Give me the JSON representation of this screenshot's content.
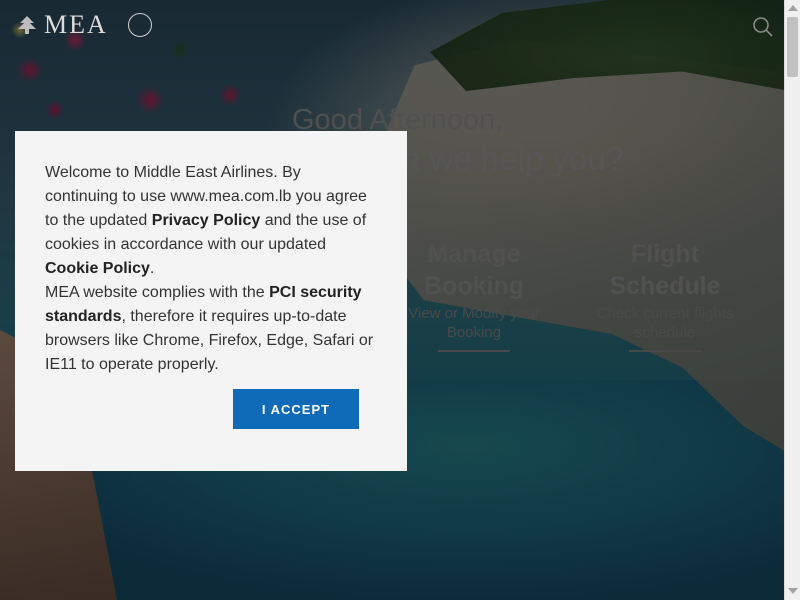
{
  "header": {
    "logo_text": "MEA",
    "logo_icon": "cedar-icon",
    "alliance_icon": "globe-icon",
    "search_icon": "search-icon"
  },
  "hero": {
    "greeting": "Good Afternoon,",
    "question": "How can we help you?"
  },
  "tiles": [
    {
      "title": "Manage Booking",
      "subtitle": "View or Modify your Booking"
    },
    {
      "title": "Flight Schedule",
      "subtitle": "Check current flights schedule"
    }
  ],
  "cookie_dialog": {
    "text_1": "Welcome to Middle East Airlines. By continuing to use www.mea.com.lb you agree to the updated ",
    "privacy_link": "Privacy Policy",
    "text_2": " and the use of cookies in accordance with our updated ",
    "cookie_link": "Cookie Policy",
    "text_3": ".",
    "text_4": "MEA website complies with the ",
    "pci_link": "PCI security standards",
    "text_5": ", therefore it requires up-to-date browsers like Chrome, Firefox, Edge, Safari or IE11 to operate properly.",
    "accept_label": "I ACCEPT"
  },
  "colors": {
    "accent": "#0f6bb8",
    "dialog_bg": "#f4f4f4"
  }
}
